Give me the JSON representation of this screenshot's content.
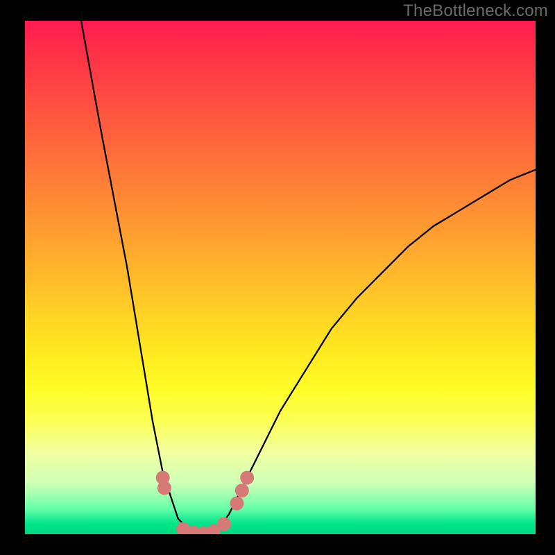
{
  "watermark": "TheBottleneck.com",
  "chart_data": {
    "type": "line",
    "title": "",
    "xlabel": "",
    "ylabel": "",
    "xlim": [
      0,
      100
    ],
    "ylim": [
      0,
      100
    ],
    "grid": false,
    "legend": false,
    "series": [
      {
        "name": "curve",
        "color": "#000000",
        "x": [
          11,
          15,
          20,
          25,
          27,
          29,
          30,
          32,
          34,
          36,
          38,
          40,
          42,
          45,
          50,
          55,
          60,
          65,
          70,
          75,
          80,
          85,
          90,
          95,
          100
        ],
        "y": [
          100,
          78,
          52,
          22,
          12,
          6,
          3,
          1,
          0,
          0,
          1,
          4,
          8,
          14,
          24,
          32,
          40,
          46,
          51,
          56,
          60,
          63,
          66,
          69,
          71
        ]
      }
    ],
    "markers": [
      {
        "name": "marker",
        "x": 27.0,
        "y": 11.0,
        "color": "#d67a78"
      },
      {
        "name": "marker",
        "x": 27.3,
        "y": 9.0,
        "color": "#d67a78"
      },
      {
        "name": "marker",
        "x": 31.0,
        "y": 1.0,
        "color": "#d67a78"
      },
      {
        "name": "marker",
        "x": 33.0,
        "y": 0.3,
        "color": "#d67a78"
      },
      {
        "name": "marker",
        "x": 35.0,
        "y": 0.2,
        "color": "#d67a78"
      },
      {
        "name": "marker",
        "x": 37.0,
        "y": 0.6,
        "color": "#d67a78"
      },
      {
        "name": "marker",
        "x": 39.0,
        "y": 2.0,
        "color": "#d67a78"
      },
      {
        "name": "marker",
        "x": 41.5,
        "y": 6.0,
        "color": "#d67a78"
      },
      {
        "name": "marker",
        "x": 42.5,
        "y": 8.5,
        "color": "#d67a78"
      },
      {
        "name": "marker",
        "x": 43.5,
        "y": 11.0,
        "color": "#d67a78"
      }
    ],
    "background_gradient": {
      "top_color": "#ff1a52",
      "bottom_color": "#00d880",
      "description": "red at top through orange, yellow, light-green to green at bottom"
    }
  }
}
